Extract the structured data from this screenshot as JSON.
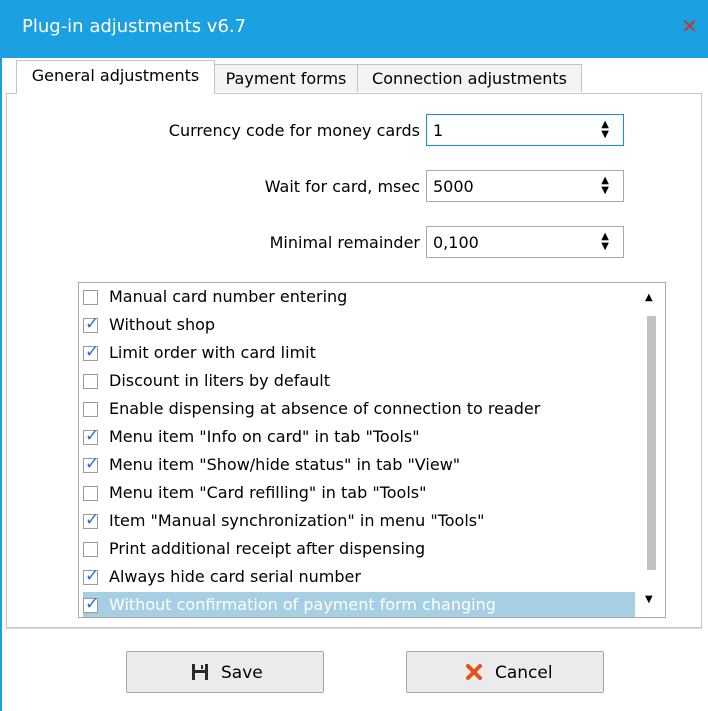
{
  "window": {
    "title": "Plug-in adjustments v6.7",
    "close_glyph": "✕"
  },
  "tabs": [
    {
      "label": "General adjustments",
      "active": true
    },
    {
      "label": "Payment forms",
      "active": false
    },
    {
      "label": "Connection adjustments",
      "active": false
    }
  ],
  "fields": [
    {
      "label": "Currency code for money cards",
      "value": "1"
    },
    {
      "label": "Wait for card, msec",
      "value": "5000"
    },
    {
      "label": "Minimal remainder",
      "value": "0,100"
    }
  ],
  "options": [
    {
      "label": "Manual card number entering",
      "checked": false
    },
    {
      "label": "Without shop",
      "checked": true
    },
    {
      "label": "Limit order with card limit",
      "checked": true
    },
    {
      "label": "Discount in liters by default",
      "checked": false
    },
    {
      "label": "Enable dispensing at absence of connection to reader",
      "checked": false
    },
    {
      "label": "Menu item \"Info on card\" in tab \"Tools\"",
      "checked": true
    },
    {
      "label": "Menu item \"Show/hide status\" in tab \"View\"",
      "checked": true
    },
    {
      "label": "Menu item \"Card refilling\" in tab \"Tools\"",
      "checked": false
    },
    {
      "label": "Item \"Manual synchronization\" in menu \"Tools\"",
      "checked": true
    },
    {
      "label": "Print additional receipt after dispensing",
      "checked": false
    },
    {
      "label": "Always hide card serial number",
      "checked": true
    },
    {
      "label": "Without confirmation of payment form changing",
      "checked": true,
      "selected": true
    }
  ],
  "buttons": {
    "save_label": "Save",
    "cancel_label": "Cancel",
    "save_icon": "save-icon",
    "cancel_icon": "cross-icon"
  },
  "colors": {
    "titlebar": "#1ba1e2",
    "selection": "#a6cfe3",
    "checkmark": "#2b6dc9",
    "close": "#c0392b",
    "cancel_icon": "#e0531c"
  }
}
